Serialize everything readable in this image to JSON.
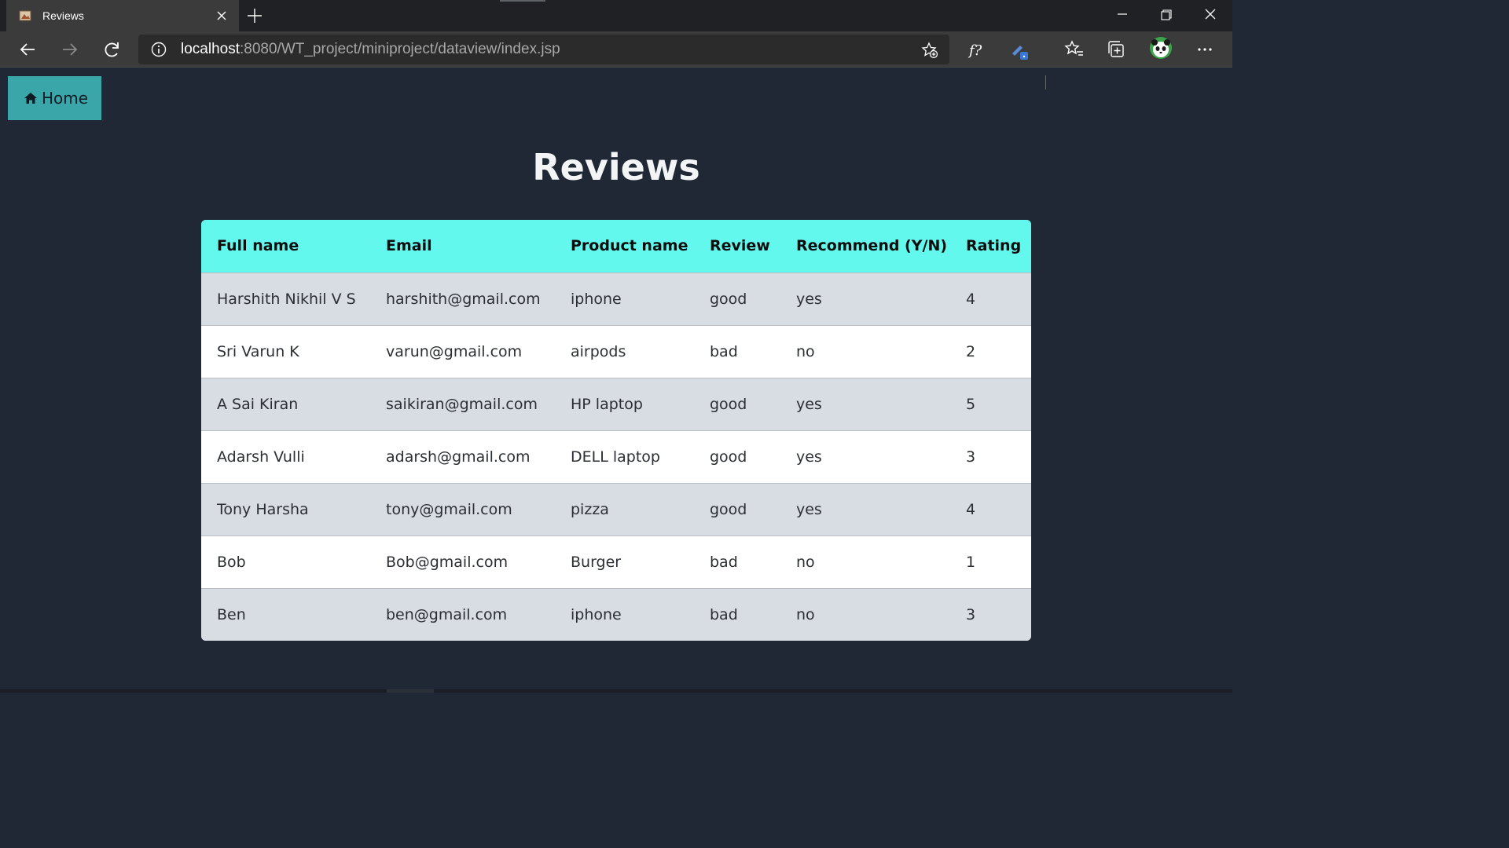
{
  "browser": {
    "tab_title": "Reviews",
    "url_host": "localhost",
    "url_rest": ":8080/WT_project/miniproject/dataview/index.jsp",
    "icons": [
      "tab-favicon-icon",
      "close-tab-icon",
      "new-tab-icon",
      "minimize-icon",
      "restore-icon",
      "window-close-icon",
      "back-icon",
      "forward-icon",
      "refresh-icon",
      "site-info-icon",
      "add-favorite-icon",
      "formula-extension-icon",
      "pen-extension-icon",
      "favorites-icon",
      "collections-icon",
      "profile-avatar-icon",
      "more-icon"
    ]
  },
  "page": {
    "home_label": "Home",
    "title": "Reviews"
  },
  "table": {
    "headers": [
      "Full name",
      "Email",
      "Product name",
      "Review",
      "Recommend (Y/N)",
      "Rating"
    ],
    "rows": [
      [
        "Harshith Nikhil V S",
        "harshith@gmail.com",
        "iphone",
        "good",
        "yes",
        "4"
      ],
      [
        "Sri Varun K",
        "varun@gmail.com",
        "airpods",
        "bad",
        "no",
        "2"
      ],
      [
        "A Sai Kiran",
        "saikiran@gmail.com",
        "HP laptop",
        "good",
        "yes",
        "5"
      ],
      [
        "Adarsh Vulli",
        "adarsh@gmail.com",
        "DELL laptop",
        "good",
        "yes",
        "3"
      ],
      [
        "Tony Harsha",
        "tony@gmail.com",
        "pizza",
        "good",
        "yes",
        "4"
      ],
      [
        "Bob",
        "Bob@gmail.com",
        "Burger",
        "bad",
        "no",
        "1"
      ],
      [
        "Ben",
        "ben@gmail.com",
        "iphone",
        "bad",
        "no",
        "3"
      ]
    ]
  },
  "colors": {
    "page_bg": "#202835",
    "home_button": "#3aa6a9",
    "table_header": "#62f8ee",
    "row_odd": "#d8dce3",
    "row_even": "#ffffff"
  }
}
